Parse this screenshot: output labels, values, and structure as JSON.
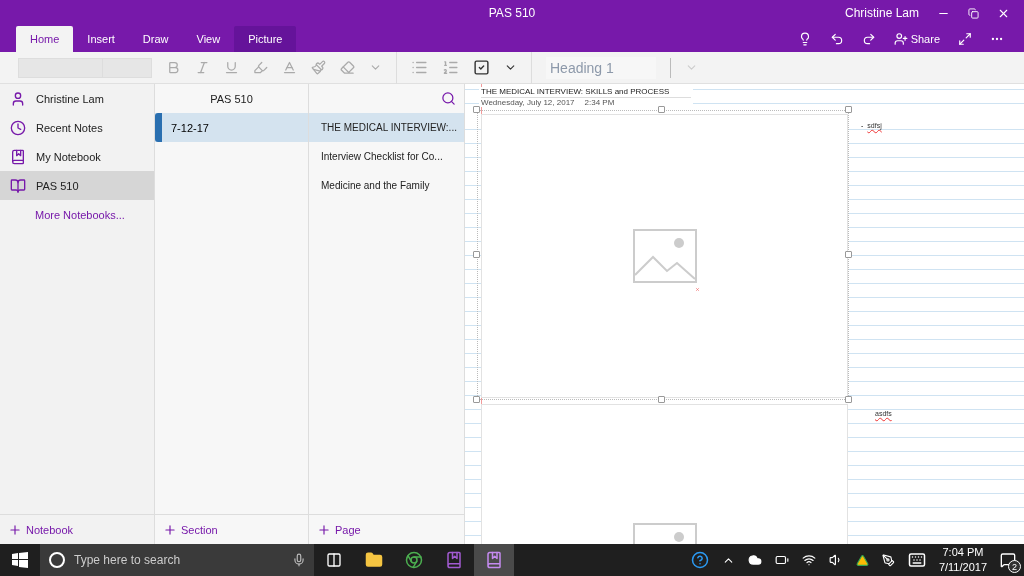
{
  "window": {
    "title": "PAS 510",
    "user": "Christine Lam"
  },
  "ribbon_tabs": [
    {
      "label": "Home",
      "selected": true,
      "contextual": false
    },
    {
      "label": "Insert",
      "selected": false,
      "contextual": false
    },
    {
      "label": "Draw",
      "selected": false,
      "contextual": false
    },
    {
      "label": "View",
      "selected": false,
      "contextual": false
    },
    {
      "label": "Picture",
      "selected": false,
      "contextual": true
    }
  ],
  "share": {
    "label": "Share"
  },
  "toolbar": {
    "style": {
      "value": "Heading 1",
      "disabled": true
    }
  },
  "navigation": {
    "account": "Christine Lam",
    "items": [
      {
        "label": "Recent Notes",
        "selected": false
      },
      {
        "label": "My Notebook",
        "selected": false
      },
      {
        "label": "PAS 510",
        "selected": true
      }
    ],
    "more": "More Notebooks...",
    "add": "Notebook"
  },
  "sections": {
    "title": "PAS 510",
    "items": [
      {
        "label": "7-12-17",
        "selected": true,
        "color": "#2a6fb0"
      }
    ],
    "add": "Section"
  },
  "pages": {
    "items": [
      {
        "label": "THE MEDICAL INTERVIEW:...",
        "selected": true
      },
      {
        "label": "Interview Checklist for Co...",
        "selected": false
      },
      {
        "label": "Medicine and the Family",
        "selected": false
      }
    ],
    "add": "Page"
  },
  "page": {
    "title": "THE MEDICAL INTERVIEW: SKILLS and PROCESS",
    "date": "Wednesday, July 12, 2017",
    "time": "2:34 PM",
    "notes": [
      {
        "bullet": "-",
        "text": "sdfsj"
      },
      {
        "text": "asdfs"
      }
    ]
  },
  "taskbar": {
    "search_placeholder": "Type here to search",
    "time": "7:04 PM",
    "date": "7/11/2017",
    "notifications": "2"
  }
}
